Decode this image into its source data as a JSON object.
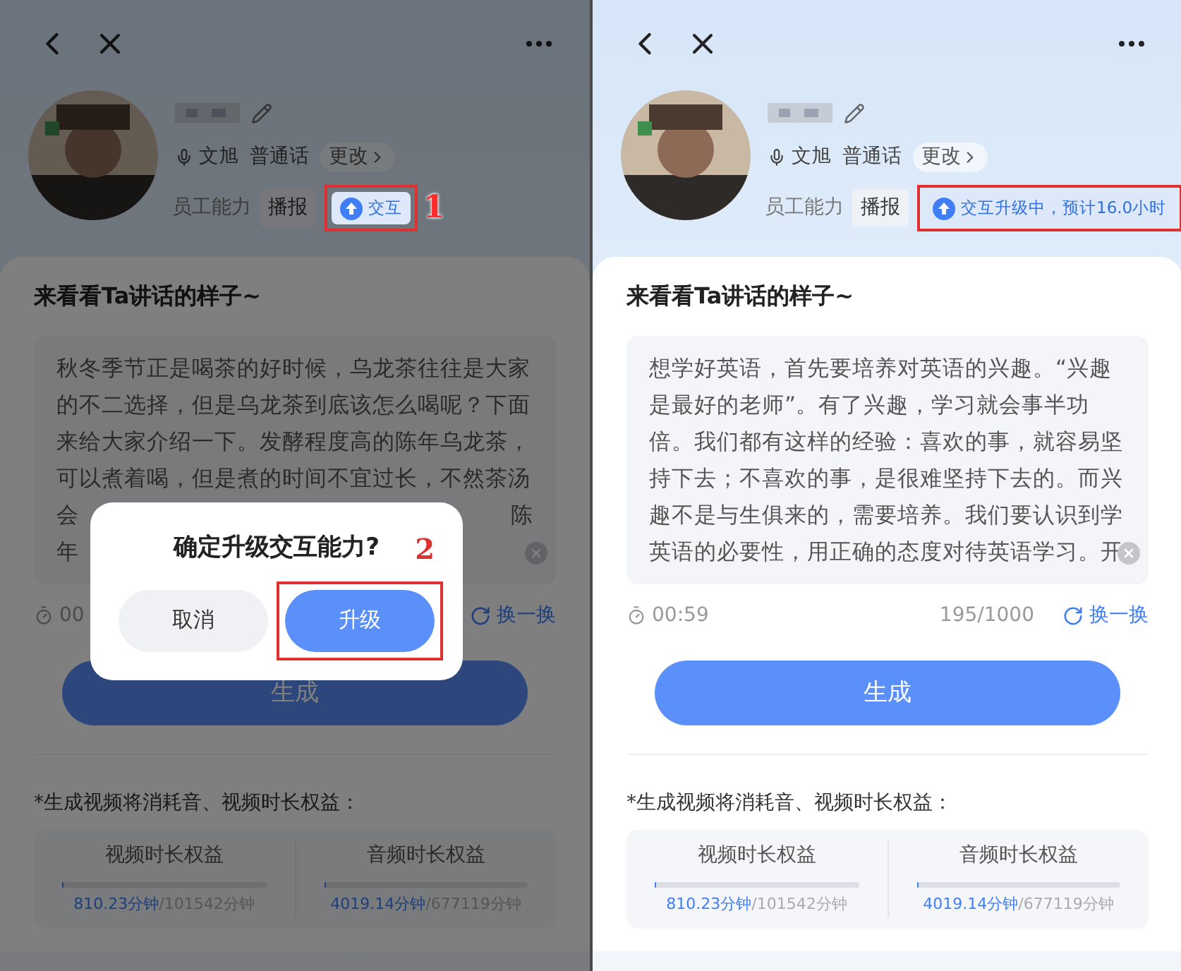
{
  "phones": [
    {
      "dimmed": true,
      "voice": {
        "name": "文旭",
        "dialect": "普通话",
        "change": "更改"
      },
      "abilities_label": "员工能力",
      "abilities": [
        {
          "kind": "plain",
          "label": "播报",
          "highlighted": false
        },
        {
          "kind": "upgrade",
          "label": "交互",
          "highlighted": true,
          "annotation": "1"
        }
      ],
      "section_title": "来看看Ta讲话的样子~",
      "script_lines": [
        {
          "kind": "full",
          "text": "秋冬季节正是喝茶的好时候，乌龙茶往往是大家"
        },
        {
          "kind": "full",
          "text": "的不二选择，但是乌龙茶到底该怎么喝呢？下面"
        },
        {
          "kind": "full",
          "text": "来给大家介绍一下。发酵程度高的陈年乌龙茶，"
        },
        {
          "kind": "full",
          "text": "可以煮着喝，但是煮的时间不宜过长，不然茶汤"
        },
        {
          "kind": "split",
          "left": "会",
          "right": "陈"
        },
        {
          "kind": "split",
          "left": "年"
        }
      ],
      "timer": "00",
      "shuffle": "换一换",
      "generate": "生成",
      "note": "*生成视频将消耗音、视频时长权益：",
      "benefits": [
        {
          "title": "视频时长权益",
          "level": 0.008,
          "used": "810.23分钟",
          "total": "/101542分钟"
        },
        {
          "title": "音频时长权益",
          "level": 0.006,
          "used": "4019.14分钟",
          "total": "/677119分钟"
        }
      ],
      "dialog": {
        "title": "确定升级交互能力?",
        "cancel": "取消",
        "confirm": "升级",
        "confirm_highlighted": true,
        "annotation": "2"
      }
    },
    {
      "dimmed": false,
      "voice": {
        "name": "文旭",
        "dialect": "普通话",
        "change": "更改"
      },
      "abilities_label": "员工能力",
      "abilities": [
        {
          "kind": "plain",
          "label": "播报",
          "highlighted": false
        },
        {
          "kind": "upgrade",
          "label": "交互升级中，预计16.0小时",
          "highlighted": true
        }
      ],
      "section_title": "来看看Ta讲话的样子~",
      "script_lines": [
        {
          "kind": "full",
          "text": "想学好英语，首先要培养对英语的兴趣。“兴趣"
        },
        {
          "kind": "full",
          "text": "是最好的老师”。有了兴趣，学习就会事半功"
        },
        {
          "kind": "full",
          "text": "倍。我们都有这样的经验：喜欢的事，就容易坚"
        },
        {
          "kind": "full",
          "text": "持下去；不喜欢的事，是很难坚持下去的。而兴"
        },
        {
          "kind": "full",
          "text": "趣不是与生俱来的，需要培养。我们要认识到学"
        },
        {
          "kind": "full",
          "text": "英语的必要性，用正确的态度对待英语学习。开"
        }
      ],
      "timer": "00:59",
      "count": "195/1000",
      "shuffle": "换一换",
      "generate": "生成",
      "note": "*生成视频将消耗音、视频时长权益：",
      "benefits": [
        {
          "title": "视频时长权益",
          "level": 0.008,
          "used": "810.23分钟",
          "total": "/101542分钟"
        },
        {
          "title": "音频时长权益",
          "level": 0.006,
          "used": "4019.14分钟",
          "total": "/677119分钟"
        }
      ]
    }
  ]
}
